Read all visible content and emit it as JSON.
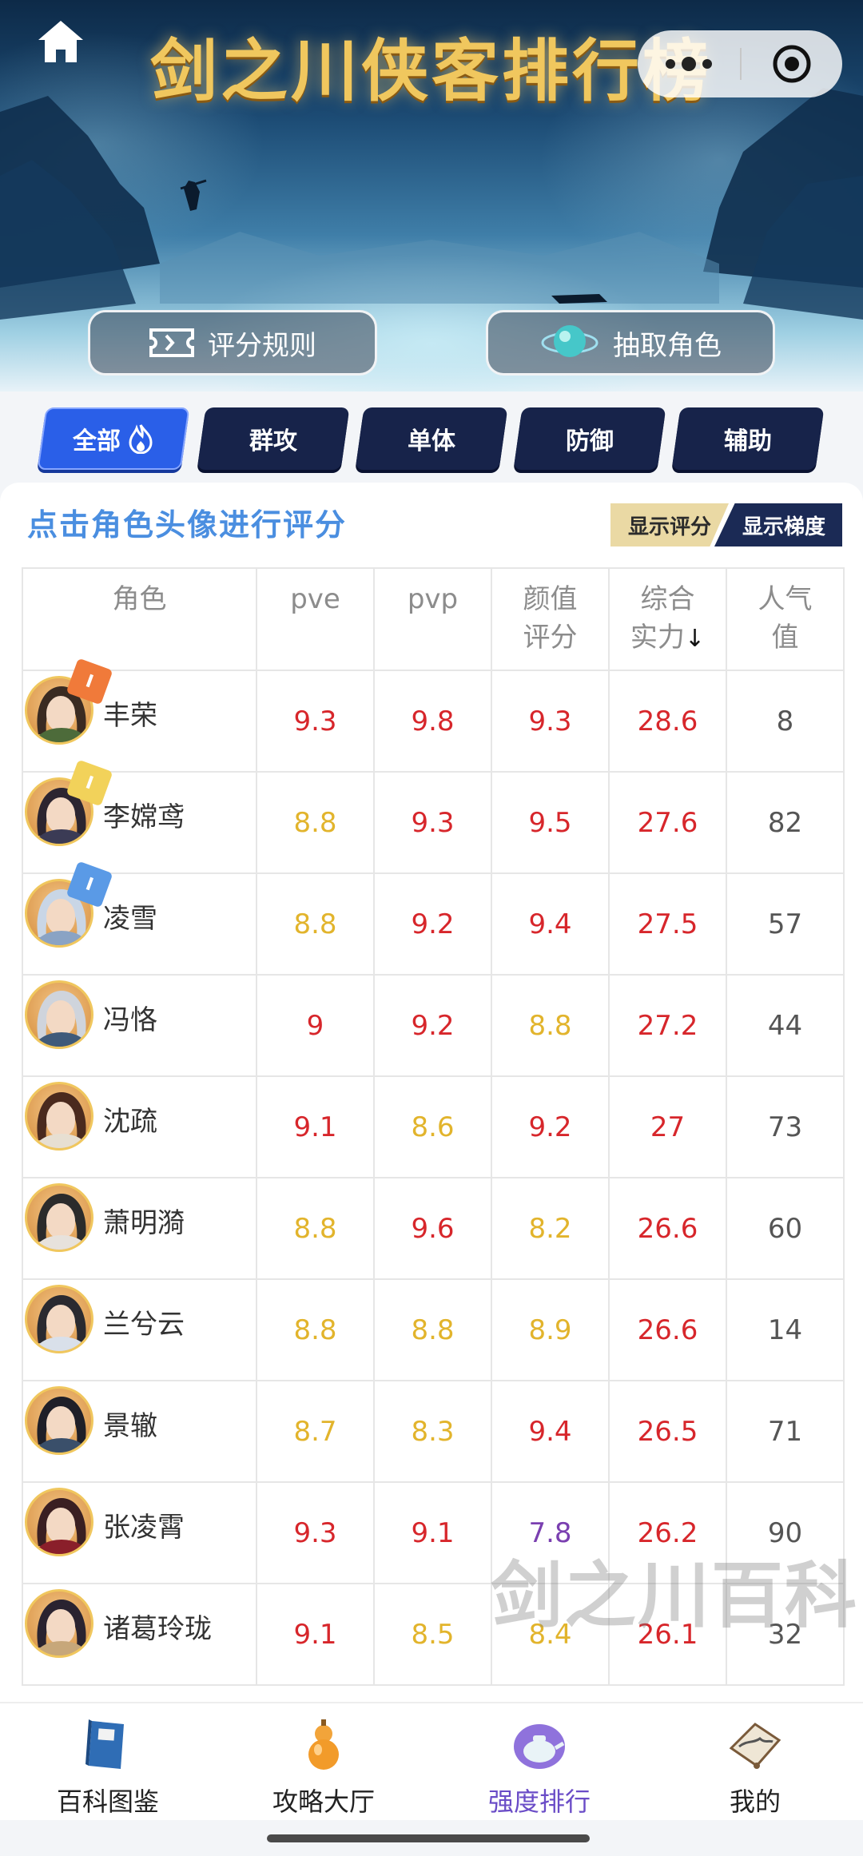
{
  "banner": {
    "title": "剑之川侠客排行榜",
    "rules_label": "评分规则",
    "draw_label": "抽取角色"
  },
  "filter_tabs": [
    {
      "label": "全部",
      "active": true
    },
    {
      "label": "群攻",
      "active": false
    },
    {
      "label": "单体",
      "active": false
    },
    {
      "label": "防御",
      "active": false
    },
    {
      "label": "辅助",
      "active": false
    }
  ],
  "hint": "点击角色头像进行评分",
  "toggle": {
    "score_label": "显示评分",
    "tier_label": "显示梯度"
  },
  "table": {
    "headers": {
      "role": "角色",
      "pve": "pve",
      "pvp": "pvp",
      "looks": [
        "颜值",
        "评分"
      ],
      "overall": [
        "综合",
        "实力"
      ],
      "popularity": [
        "人气",
        "值"
      ],
      "sort_indicator": "↓"
    },
    "rows": [
      {
        "name": "丰荣",
        "badge": "I",
        "badge_color": "#f07a3a",
        "pve": "9.3",
        "pvp": "9.8",
        "looks": "9.3",
        "overall": "28.6",
        "popularity": "8",
        "colors": {
          "pve": "red",
          "pvp": "red",
          "looks": "red"
        }
      },
      {
        "name": "李嫦鸢",
        "badge": "I",
        "badge_color": "#f2d25a",
        "pve": "8.8",
        "pvp": "9.3",
        "looks": "9.5",
        "overall": "27.6",
        "popularity": "82",
        "colors": {
          "pve": "yellow",
          "pvp": "red",
          "looks": "red"
        }
      },
      {
        "name": "凌雪",
        "badge": "I",
        "badge_color": "#5a9ae6",
        "pve": "8.8",
        "pvp": "9.2",
        "looks": "9.4",
        "overall": "27.5",
        "popularity": "57",
        "colors": {
          "pve": "yellow",
          "pvp": "red",
          "looks": "red"
        }
      },
      {
        "name": "冯恪",
        "badge": "",
        "badge_color": "",
        "pve": "9",
        "pvp": "9.2",
        "looks": "8.8",
        "overall": "27.2",
        "popularity": "44",
        "colors": {
          "pve": "red",
          "pvp": "red",
          "looks": "yellow"
        }
      },
      {
        "name": "沈疏",
        "badge": "",
        "badge_color": "",
        "pve": "9.1",
        "pvp": "8.6",
        "looks": "9.2",
        "overall": "27",
        "popularity": "73",
        "colors": {
          "pve": "red",
          "pvp": "yellow",
          "looks": "red"
        }
      },
      {
        "name": "萧明漪",
        "badge": "",
        "badge_color": "",
        "pve": "8.8",
        "pvp": "9.6",
        "looks": "8.2",
        "overall": "26.6",
        "popularity": "60",
        "colors": {
          "pve": "yellow",
          "pvp": "red",
          "looks": "yellow"
        }
      },
      {
        "name": "兰兮云",
        "badge": "",
        "badge_color": "",
        "pve": "8.8",
        "pvp": "8.8",
        "looks": "8.9",
        "overall": "26.6",
        "popularity": "14",
        "colors": {
          "pve": "yellow",
          "pvp": "yellow",
          "looks": "yellow"
        }
      },
      {
        "name": "景辙",
        "badge": "",
        "badge_color": "",
        "pve": "8.7",
        "pvp": "8.3",
        "looks": "9.4",
        "overall": "26.5",
        "popularity": "71",
        "colors": {
          "pve": "yellow",
          "pvp": "yellow",
          "looks": "red"
        }
      },
      {
        "name": "张凌霄",
        "badge": "",
        "badge_color": "",
        "pve": "9.3",
        "pvp": "9.1",
        "looks": "7.8",
        "overall": "26.2",
        "popularity": "90",
        "colors": {
          "pve": "red",
          "pvp": "red",
          "looks": "purple"
        }
      },
      {
        "name": "诸葛玲珑",
        "badge": "",
        "badge_color": "",
        "pve": "9.1",
        "pvp": "8.5",
        "looks": "8.4",
        "overall": "26.1",
        "popularity": "32",
        "colors": {
          "pve": "red",
          "pvp": "yellow",
          "looks": "yellow"
        }
      }
    ]
  },
  "watermark": "剑之川百科",
  "bottom_nav": [
    {
      "label": "百科图鉴",
      "icon": "book-icon",
      "active": false
    },
    {
      "label": "攻略大厅",
      "icon": "gourd-icon",
      "active": false
    },
    {
      "label": "强度排行",
      "icon": "teapot-icon",
      "active": true
    },
    {
      "label": "我的",
      "icon": "fan-icon",
      "active": false
    }
  ],
  "colors": {
    "red": "#d7262b",
    "yellow": "#e2b42c",
    "purple": "#7a3fb0",
    "tab_bg": "#17234a",
    "tab_active": "#2a5fe8",
    "hint_blue": "#4a8ee0",
    "nav_active": "#6a4cc7"
  }
}
